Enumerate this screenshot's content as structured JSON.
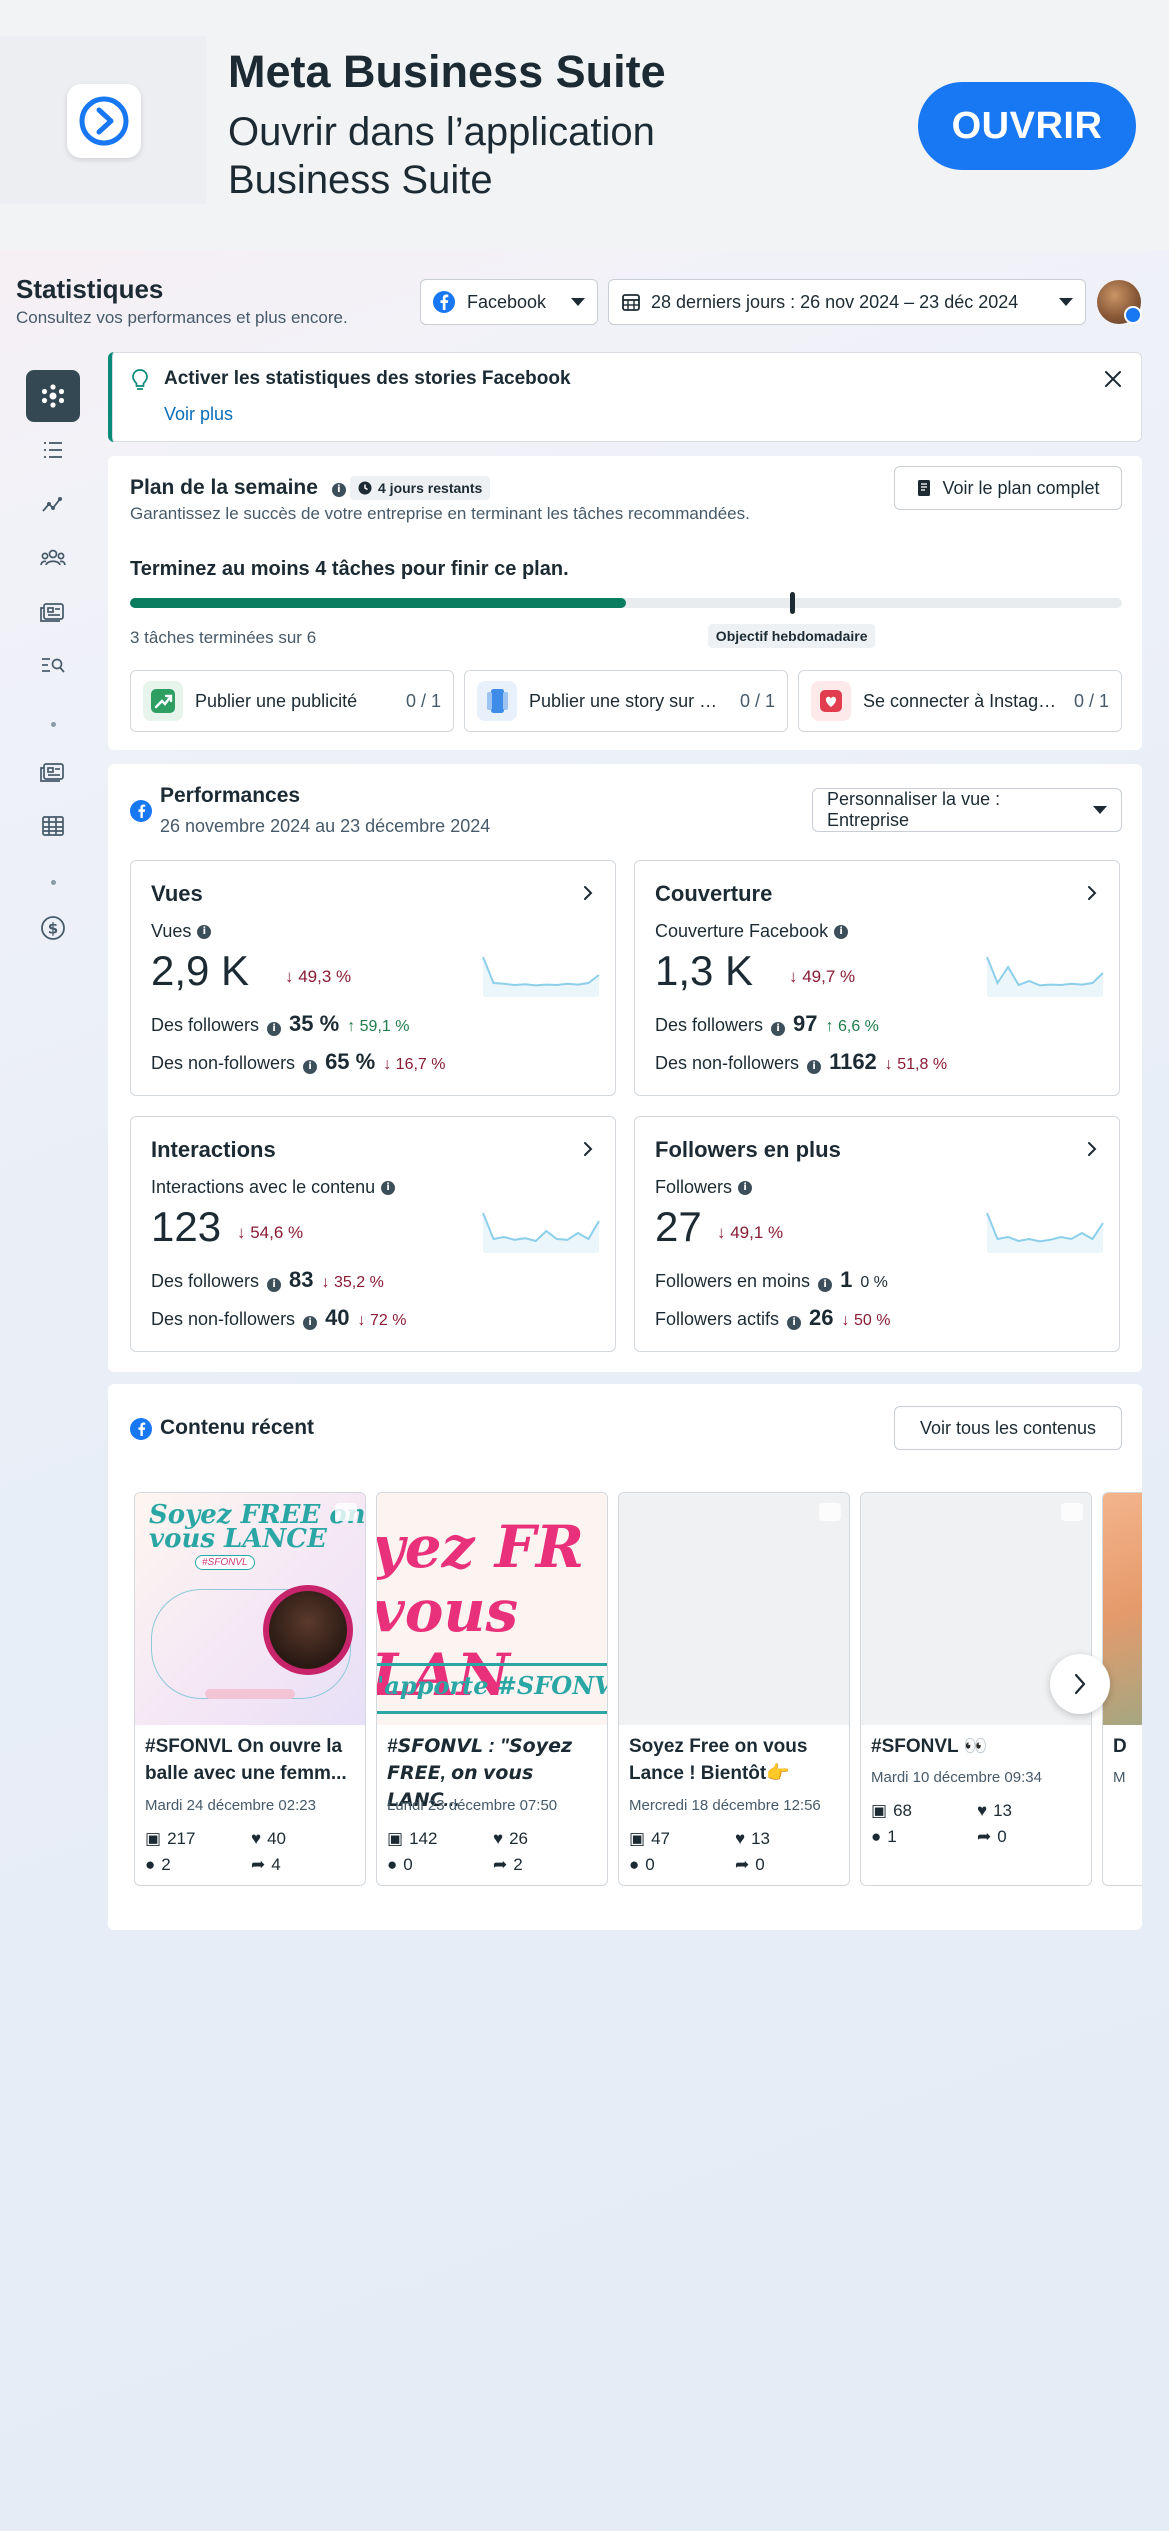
{
  "banner": {
    "title": "Meta Business Suite",
    "subtitle": "Ouvrir dans l’application Business Suite",
    "open_button": "OUVRIR"
  },
  "header": {
    "title": "Statistiques",
    "subtitle": "Consultez vos performances et plus encore.",
    "platform_select": "Facebook",
    "date_range": "28 derniers jours : 26 nov 2024 – 23 déc 2024"
  },
  "sidebar": {
    "items": [
      "overview-icon",
      "content-list-icon",
      "trend-icon",
      "audience-icon",
      "ads-icon",
      "search-list-icon",
      "news-icon",
      "table-icon",
      "dollar-icon"
    ]
  },
  "alert": {
    "title": "Activer les statistiques des stories Facebook",
    "link": "Voir plus"
  },
  "plan": {
    "title": "Plan de la semaine",
    "days_badge": "4 jours restants",
    "subtitle": "Garantissez le succès de votre entreprise en terminant les tâches recommandées.",
    "view_button": "Voir le plan complet",
    "goal_text": "Terminez au moins 4 tâches pour finir ce plan.",
    "progress_fraction": 0.5,
    "goal_fraction": 0.667,
    "goal_label": "Objectif hebdomadaire",
    "tasks_done": "3 tâches terminées sur 6",
    "tasks": [
      {
        "label": "Publier une publicité",
        "count": "0 / 1",
        "color": "#2e9e62"
      },
      {
        "label": "Publier une story sur Fa...",
        "count": "0 / 1",
        "color": "#3d8ce8"
      },
      {
        "label": "Se connecter à Instagram",
        "count": "0 / 1",
        "color": "#e23d4f"
      }
    ]
  },
  "performances": {
    "title": "Performances",
    "subtitle": "26 novembre 2024 au 23 décembre 2024",
    "view_select": "Personnaliser la vue : Entreprise",
    "metrics": [
      {
        "title": "Vues",
        "label": "Vues",
        "value": "2,9 K",
        "delta": "↓ 49,3 %",
        "delta_dir": "down",
        "row1_label": "Des followers",
        "row1_value": "35 %",
        "row1_delta": "↑ 59,1 %",
        "row1_dir": "up",
        "row2_label": "Des non-followers",
        "row2_value": "65 %",
        "row2_delta": "↓ 16,7 %",
        "row2_dir": "down",
        "spark": [
          0.95,
          0.3,
          0.28,
          0.25,
          0.27,
          0.24,
          0.26,
          0.25,
          0.28,
          0.26,
          0.3,
          0.5
        ]
      },
      {
        "title": "Couverture",
        "label": "Couverture Facebook",
        "value": "1,3 K",
        "delta": "↓ 49,7 %",
        "delta_dir": "down",
        "row1_label": "Des followers",
        "row1_value": "97",
        "row1_delta": "↑ 6,6 %",
        "row1_dir": "up",
        "row2_label": "Des non-followers",
        "row2_value": "1162",
        "row2_delta": "↓ 51,8 %",
        "row2_dir": "down",
        "spark": [
          0.95,
          0.3,
          0.7,
          0.25,
          0.35,
          0.24,
          0.26,
          0.25,
          0.28,
          0.26,
          0.3,
          0.55
        ]
      },
      {
        "title": "Interactions",
        "label": "Interactions avec le contenu",
        "value": "123",
        "delta": "↓ 54,6 %",
        "delta_dir": "down",
        "row1_label": "Des followers",
        "row1_value": "83",
        "row1_delta": "↓ 35,2 %",
        "row1_dir": "down",
        "row2_label": "Des non-followers",
        "row2_value": "40",
        "row2_delta": "↓ 72 %",
        "row2_dir": "down",
        "spark": [
          0.95,
          0.3,
          0.35,
          0.28,
          0.32,
          0.25,
          0.5,
          0.3,
          0.28,
          0.45,
          0.3,
          0.75
        ]
      },
      {
        "title": "Followers en plus",
        "label": "Followers",
        "value": "27",
        "delta": "↓ 49,1 %",
        "delta_dir": "down",
        "row1_label": "Followers en moins",
        "row1_value": "1",
        "row1_delta": "0 %",
        "row1_dir": "neutral",
        "row2_label": "Followers actifs",
        "row2_value": "26",
        "row2_delta": "↓ 50 %",
        "row2_dir": "down",
        "spark": [
          0.95,
          0.3,
          0.35,
          0.25,
          0.3,
          0.24,
          0.28,
          0.35,
          0.3,
          0.45,
          0.3,
          0.7
        ]
      }
    ]
  },
  "recent": {
    "title": "Contenu récent",
    "view_all": "Voir tous les contenus",
    "posts": [
      {
        "title": "#SFONVL On ouvre la balle avec une femm...",
        "date": "Mardi 24 décembre 02:23",
        "views": "217",
        "likes": "40",
        "comments": "2",
        "shares": "4",
        "thumb_text": "Soyez FREE on vous LANCE",
        "thumb_sub": "#SFONVL"
      },
      {
        "title": "#𝙎𝙁𝙊𝙉𝙑𝙇 : \"𝙎𝙤𝙮𝙚𝙯 𝙁𝙍𝙀𝙀, 𝙤𝙣 𝙫𝙤𝙪𝙨 𝙇𝘼𝙉𝘾...",
        "date": "Lundi 23 décembre 07:50",
        "views": "142",
        "likes": "26",
        "comments": "0",
        "shares": "2",
        "thumb_text": "yez FR vous LAN",
        "thumb_sub": "'apporte #SFONVI"
      },
      {
        "title": "Soyez Free on vous Lance ! Bientôt👉",
        "date": "Mercredi 18 décembre 12:56",
        "views": "47",
        "likes": "13",
        "comments": "0",
        "shares": "0"
      },
      {
        "title": "#SFONVL 👀",
        "date": "Mardi 10 décembre 09:34",
        "views": "68",
        "likes": "13",
        "comments": "1",
        "shares": "0"
      },
      {
        "title": "D",
        "date": "M"
      }
    ]
  }
}
